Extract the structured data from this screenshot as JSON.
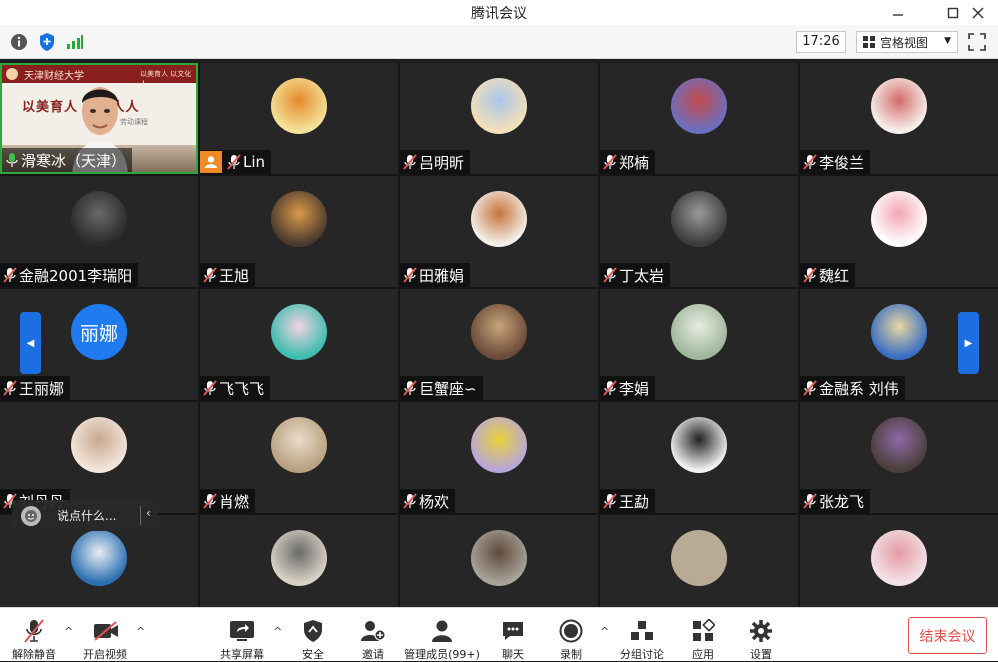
{
  "window": {
    "title": "腾讯会议"
  },
  "top_bar": {
    "clock": "17:26",
    "view_mode": "宫格视图",
    "icons": [
      "info-icon",
      "shield-icon",
      "signal-icon",
      "grid-view-icon",
      "fullscreen-icon"
    ]
  },
  "speaker": {
    "name": "滑寒冰（天津）",
    "slide_header": "天津财经大学",
    "slide_header_right": "以美育人 以文化人",
    "slogan": "以美育人 面向人人",
    "slogan_sub": "劳动课程"
  },
  "participants": [
    {
      "name": "Lin",
      "host": true,
      "avatar_color": "#f4e39a",
      "avatar_accent": "#e58a2b"
    },
    {
      "name": "吕明昕",
      "avatar_color": "#f4e0b8",
      "avatar_accent": "#a9c6ea"
    },
    {
      "name": "郑楠",
      "avatar_color": "#6b6fc0",
      "avatar_accent": "#c24a4a"
    },
    {
      "name": "李俊兰",
      "avatar_color": "#f6f1ec",
      "avatar_accent": "#d36c6c"
    },
    {
      "name": "金融2001李瑞阳",
      "avatar_color": "#2a2a2a",
      "avatar_accent": "#6a6a6a"
    },
    {
      "name": "王旭",
      "avatar_color": "#4a3a2e",
      "avatar_accent": "#d99a4a"
    },
    {
      "name": "田雅娟",
      "avatar_color": "#f3f0ea",
      "avatar_accent": "#c7723b"
    },
    {
      "name": "丁太岩",
      "avatar_color": "#3c3c3c",
      "avatar_accent": "#9a9a9a"
    },
    {
      "name": "魏红",
      "avatar_color": "#ffffff",
      "avatar_accent": "#f2a6b4"
    },
    {
      "name": "王丽娜",
      "avatar_text": "丽娜",
      "avatar_color": "#1f7cf0",
      "avatar_accent": "#1f7cf0"
    },
    {
      "name": "飞飞飞",
      "avatar_color": "#3cbcae",
      "avatar_accent": "#f2d3e0"
    },
    {
      "name": "巨蟹座∽",
      "avatar_color": "#6b4a3a",
      "avatar_accent": "#c8a57a"
    },
    {
      "name": "李娟",
      "avatar_color": "#9fb79a",
      "avatar_accent": "#e8ece3"
    },
    {
      "name": "金融系 刘伟",
      "avatar_color": "#3a6ec2",
      "avatar_accent": "#e8d7a0"
    },
    {
      "name": "刘丹丹",
      "avatar_color": "#f3e6dc",
      "avatar_accent": "#c9a78e"
    },
    {
      "name": "肖燃",
      "avatar_color": "#b9a080",
      "avatar_accent": "#e9dccb"
    },
    {
      "name": "杨欢",
      "avatar_color": "#b8a6d9",
      "avatar_accent": "#e8d23b"
    },
    {
      "name": "王勐",
      "avatar_color": "#f1f1f1",
      "avatar_accent": "#222222"
    },
    {
      "name": "张龙飞",
      "avatar_color": "#4a3e3a",
      "avatar_accent": "#8f6aa8"
    },
    {
      "name": "",
      "avatar_color": "#2a6fb0",
      "avatar_accent": "#e8eef4"
    },
    {
      "name": "",
      "avatar_color": "#d9d2c6",
      "avatar_accent": "#6a6a6a"
    },
    {
      "name": "",
      "avatar_color": "#a9a39a",
      "avatar_accent": "#5e4a3a"
    },
    {
      "name": "",
      "avatar_color": "#b9aa95",
      "avatar_accent": "#b9aa95"
    },
    {
      "name": "",
      "avatar_color": "#f3e3e8",
      "avatar_accent": "#e49aa3"
    }
  ],
  "chat_hint": {
    "placeholder": "说点什么..."
  },
  "toolbar": {
    "mute": "解除静音",
    "video": "开启视频",
    "share": "共享屏幕",
    "security": "安全",
    "invite": "邀请",
    "members": "管理成员(99+)",
    "chat": "聊天",
    "record": "录制",
    "breakout": "分组讨论",
    "apps": "应用",
    "settings": "设置",
    "end": "结束会议"
  },
  "colors": {
    "accent": "#1b6fe0",
    "end_red": "#e0534e",
    "speaker_border": "#2aa83a",
    "host_badge": "#f08a24"
  }
}
